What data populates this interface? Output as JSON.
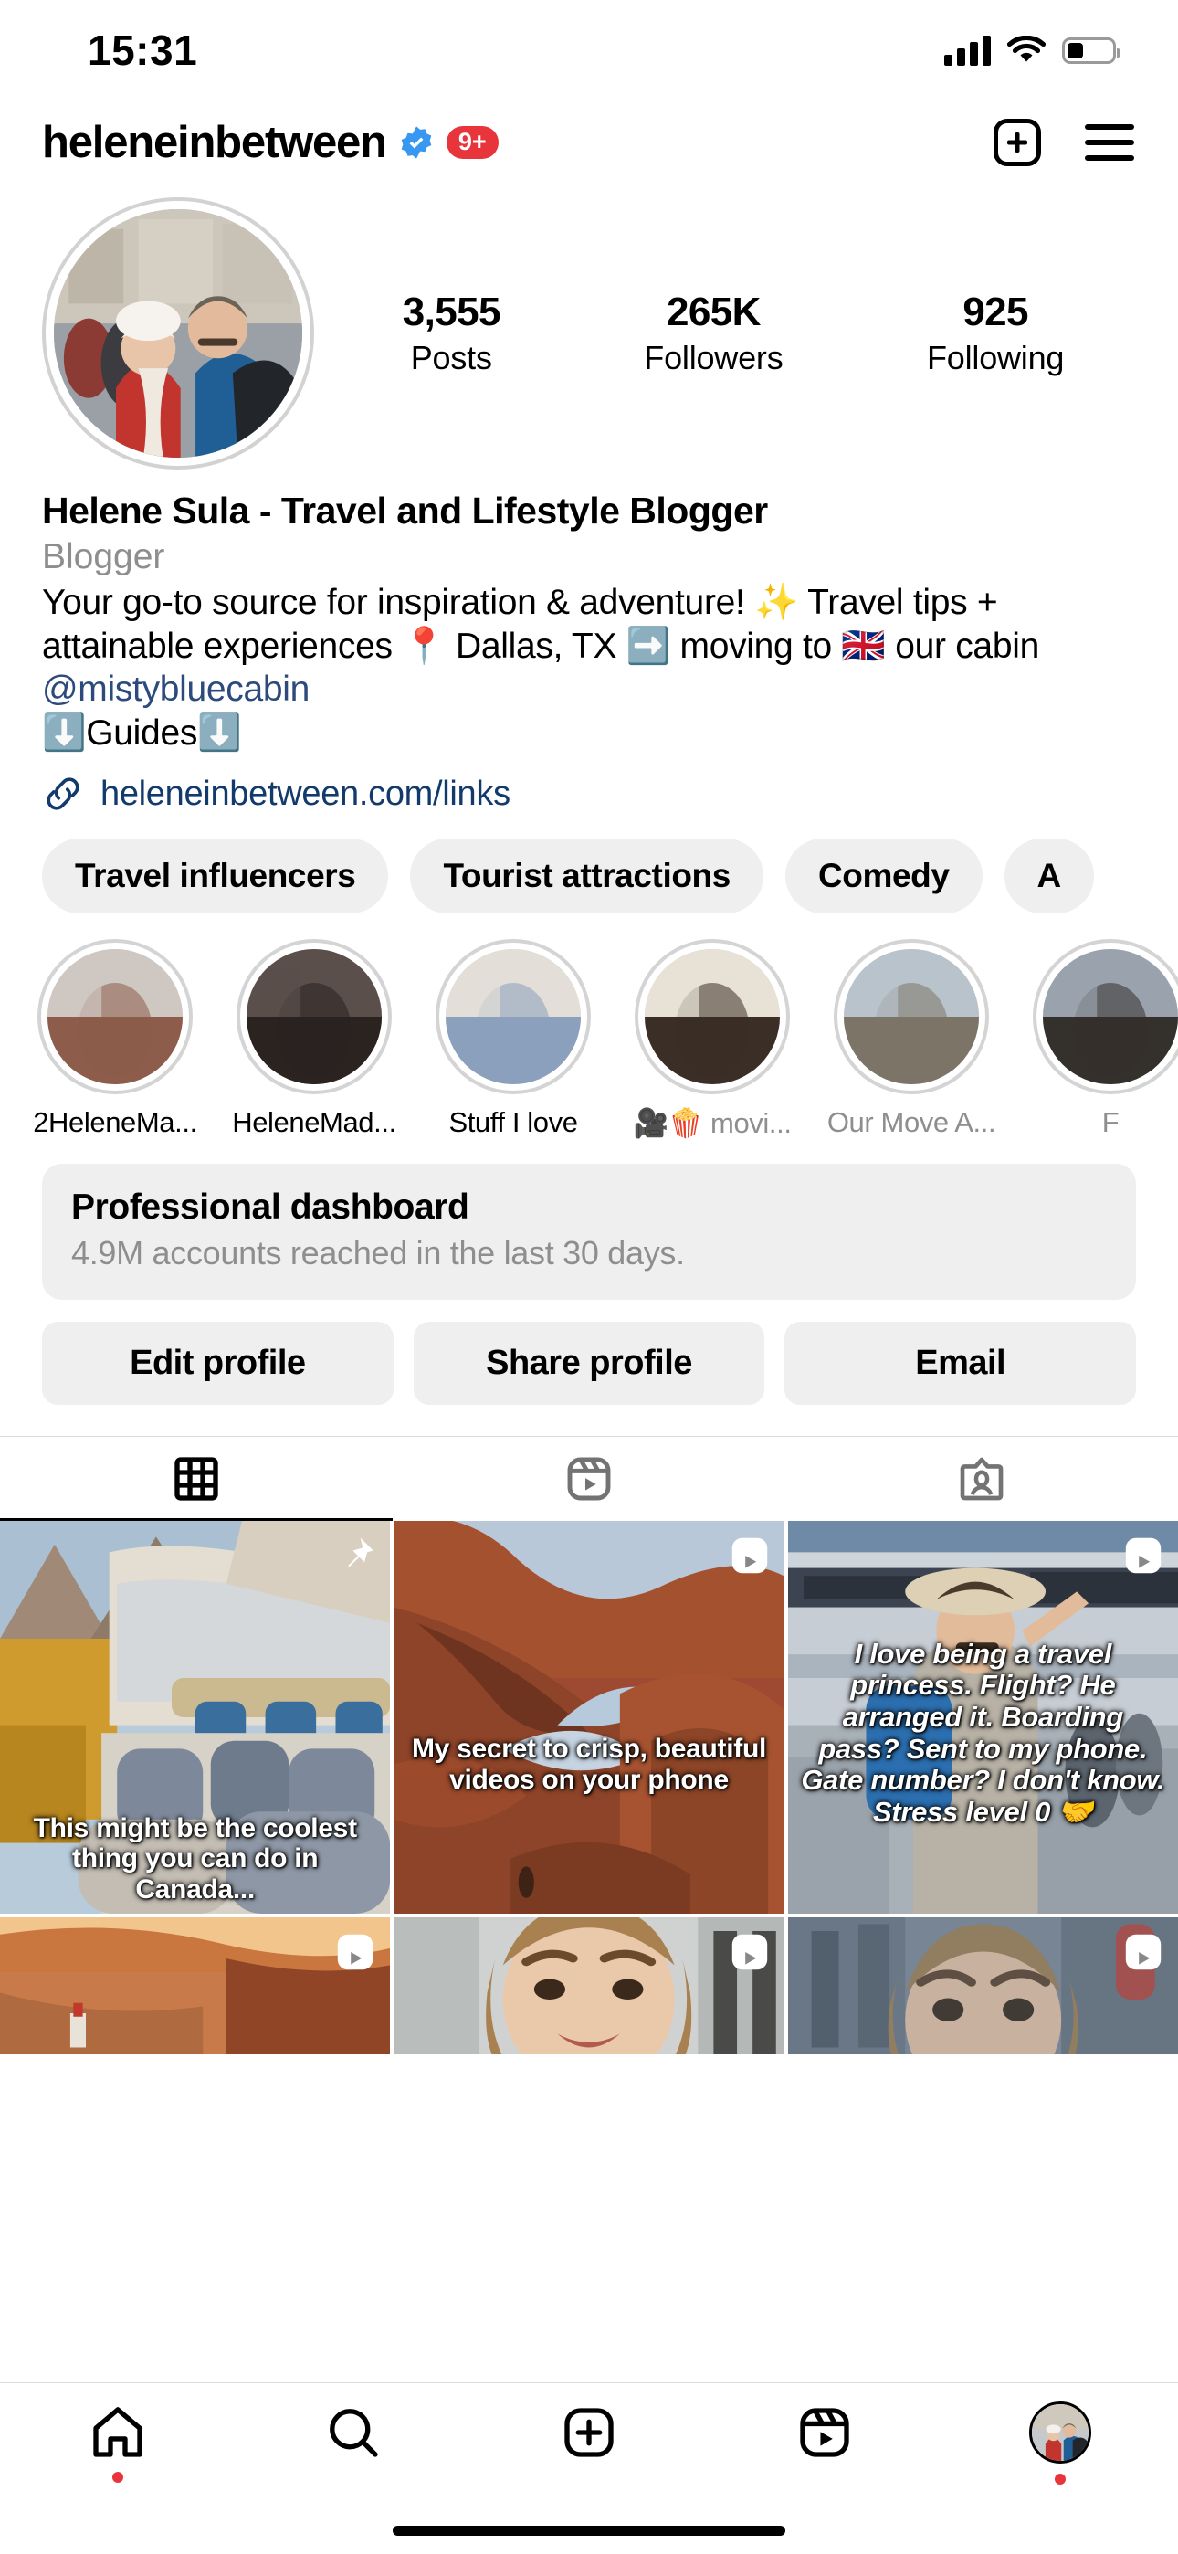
{
  "status_bar": {
    "time": "15:31",
    "signal_bars": 4,
    "wifi": true,
    "battery_percent": 36
  },
  "header": {
    "username": "heleneinbetween",
    "verified": true,
    "notification_badge": "9+",
    "new_post_icon": "plus-square-icon",
    "menu_icon": "hamburger-menu-icon"
  },
  "profile": {
    "avatar_alt": "couple-winter-street-photo",
    "stats": [
      {
        "value": "3,555",
        "label": "Posts"
      },
      {
        "value": "265K",
        "label": "Followers"
      },
      {
        "value": "925",
        "label": "Following"
      }
    ],
    "display_name": "Helene Sula - Travel and Lifestyle Blogger",
    "category": "Blogger",
    "bio_line1": "Your go-to source for inspiration & adventure! ✨ Travel tips",
    "bio_line2_a": "+ attainable experiences 📍 Dallas, TX ➡️ moving to 🇬🇧 our",
    "bio_line3_a": "cabin ",
    "bio_mention": "@mistybluecabin",
    "bio_line4": "⬇️Guides⬇️",
    "link_icon": "link-icon",
    "link_text": "heleneinbetween.com/links"
  },
  "chips": [
    {
      "label": "Travel influencers"
    },
    {
      "label": "Tourist attractions"
    },
    {
      "label": "Comedy"
    },
    {
      "label": "A"
    }
  ],
  "highlights": [
    {
      "label": "2HeleneMa...",
      "muted": false,
      "tone1": "#cfc8c2",
      "tone2": "#8d5c4a"
    },
    {
      "label": "HeleneMad...",
      "muted": false,
      "tone1": "#5a4f4a",
      "tone2": "#2a2320"
    },
    {
      "label": "Stuff I love",
      "muted": false,
      "tone1": "#e3ded7",
      "tone2": "#8aa0bd"
    },
    {
      "label": "🎥🍿 movi...",
      "muted": true,
      "tone1": "#e8e2d6",
      "tone2": "#3a2e26"
    },
    {
      "label": "Our Move A...",
      "muted": true,
      "tone1": "#b9c3cc",
      "tone2": "#7d7468"
    },
    {
      "label": "F",
      "muted": true,
      "tone1": "#9aa3ad",
      "tone2": "#34302c"
    }
  ],
  "dashboard": {
    "title": "Professional dashboard",
    "subtitle": "4.9M accounts reached in the last 30 days."
  },
  "actions": [
    {
      "label": "Edit profile"
    },
    {
      "label": "Share profile"
    },
    {
      "label": "Email"
    }
  ],
  "content_tabs": [
    {
      "name": "grid-tab",
      "icon": "grid-icon",
      "active": true
    },
    {
      "name": "reels-tab",
      "icon": "reels-icon",
      "active": false
    },
    {
      "name": "tagged-tab",
      "icon": "tagged-icon",
      "active": false
    }
  ],
  "posts_row1": [
    {
      "caption": "This might be the coolest thing you can do in Canada...",
      "badge": "pin-icon",
      "style": "canada-train",
      "caption_style": "dark-outline"
    },
    {
      "caption": "My secret to crisp, beautiful videos on your phone",
      "badge": "reels-icon",
      "style": "double-arch",
      "caption_style": "dark-outline"
    },
    {
      "caption": "I love being a travel princess. Flight? He arranged it. Boarding pass? Sent to my phone. Gate number? I don't know. Stress level 0 🤝",
      "badge": "reels-icon",
      "style": "airport",
      "caption_style": "white-italic"
    }
  ],
  "posts_row2": [
    {
      "badge": "reels-icon",
      "style": "sunset-coast"
    },
    {
      "badge": "reels-icon",
      "style": "cathedral-smile"
    },
    {
      "badge": "reels-icon",
      "style": "rain-street"
    }
  ],
  "bottom_nav": [
    {
      "name": "home-tab",
      "icon": "home-icon",
      "dot": true
    },
    {
      "name": "search-tab",
      "icon": "search-icon",
      "dot": false
    },
    {
      "name": "create-tab",
      "icon": "plus-square-icon",
      "dot": false
    },
    {
      "name": "reels-tab",
      "icon": "reels-icon",
      "dot": false
    },
    {
      "name": "profile-tab",
      "icon": "avatar-icon",
      "dot": true
    }
  ],
  "colors": {
    "accent_red": "#e8353c",
    "verified_blue": "#3897f0",
    "link_navy": "#123a6d",
    "chip_bg": "#efefef",
    "muted_text": "#8e8e8e"
  }
}
